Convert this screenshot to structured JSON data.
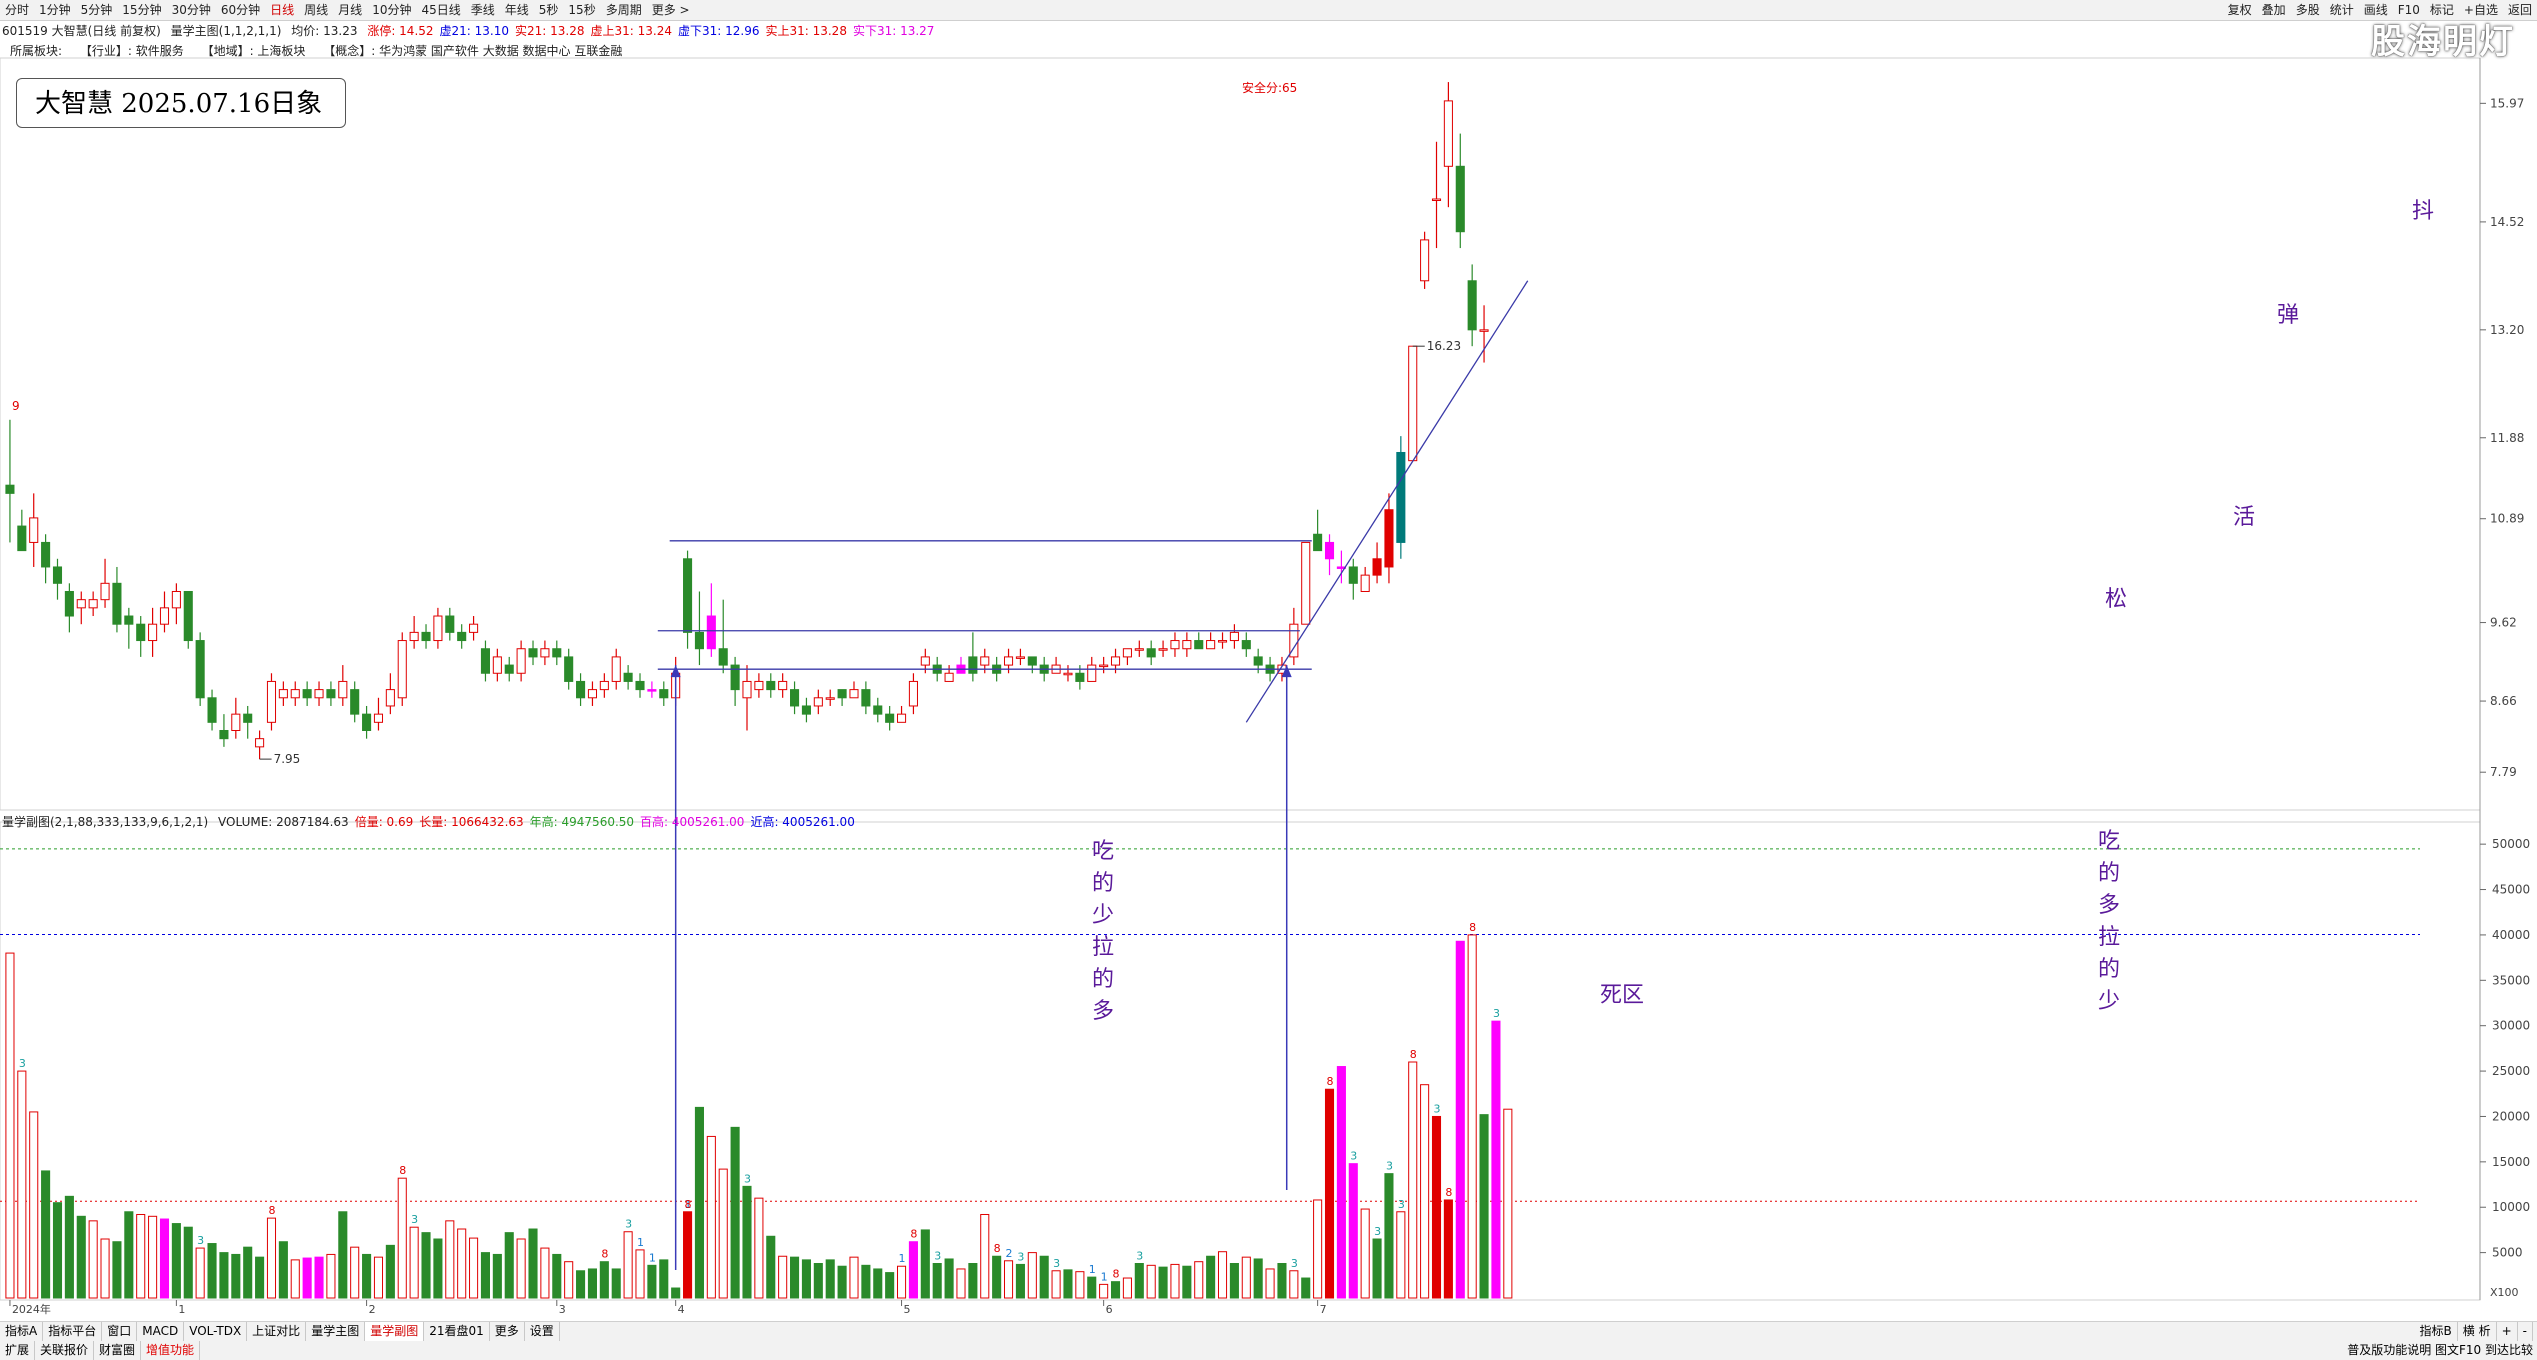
{
  "toolbar": {
    "periods": [
      "分时",
      "1分钟",
      "5分钟",
      "15分钟",
      "30分钟",
      "60分钟",
      "日线",
      "周线",
      "月线",
      "10分钟",
      "45日线",
      "季线",
      "年线",
      "5秒",
      "15秒",
      "多周期",
      "更多 >"
    ],
    "active": "日线",
    "right": [
      "复权",
      "叠加",
      "多股",
      "统计",
      "画线",
      "F10",
      "标记",
      "+自选",
      "返回"
    ]
  },
  "info": {
    "code": "601519 大智慧(日线 前复权)",
    "indicator": "量学主图(1,1,2,1,1)",
    "avg": "均价: 13.23",
    "items": [
      {
        "text": "涨停: 14.52",
        "color": "#e00000"
      },
      {
        "text": "虚21: 13.10",
        "color": "#0000e0"
      },
      {
        "text": "实21: 13.28",
        "color": "#e00000"
      },
      {
        "text": "虚上31: 13.24",
        "color": "#e00000"
      },
      {
        "text": "虚下31: 12.96",
        "color": "#0000e0"
      },
      {
        "text": "实上31: 13.28",
        "color": "#e00000"
      },
      {
        "text": "实下31: 13.27",
        "color": "#e000e0"
      }
    ]
  },
  "sector": {
    "label": "所属板块:",
    "industry": "【行业】: 软件服务",
    "region": "【地域】: 上海板块",
    "concept": "【概念】: 华为鸿蒙 国产软件 大数据 数据中心 互联金融"
  },
  "date_box": "大智慧 2025.07.16日象",
  "watermark": "股海明灯",
  "safety_score": "安全分:65",
  "annotations": {
    "left_stack": [
      "吃",
      "的",
      "少",
      "拉",
      "的",
      "多"
    ],
    "right_stack": [
      "吃",
      "的",
      "多",
      "拉",
      "的",
      "少"
    ],
    "dead_zone": "死区",
    "song": "松",
    "huo": "活",
    "dan": "弹",
    "dou": "抖"
  },
  "volume_header": {
    "name": "量学副图(2,1,88,333,133,9,6,1,2,1)",
    "items": [
      {
        "text": "VOLUME: 2087184.63",
        "color": "#222222"
      },
      {
        "text": "倍量: 0.69",
        "color": "#e00000"
      },
      {
        "text": "长量: 1066432.63",
        "color": "#e00000"
      },
      {
        "text": "年高: 4947560.50",
        "color": "#2a9d2a"
      },
      {
        "text": "百高: 4005261.00",
        "color": "#e000e0"
      },
      {
        "text": "近高: 4005261.00",
        "color": "#0000e0"
      }
    ]
  },
  "bottom": {
    "row1": [
      "指标A",
      "指标平台",
      "窗口",
      "MACD",
      "VOL-TDX",
      "上证对比",
      "量学主图",
      "量学副图",
      "21看盘01",
      "更多",
      "设置"
    ],
    "row1_active": "量学副图",
    "row2": [
      "扩展",
      "关联报价",
      "财富圈",
      "增值功能"
    ],
    "right1": [
      "指标B",
      "横 析",
      "+",
      "-"
    ],
    "right2": "普及版功能说明 图文F10 到达比较"
  },
  "chart_data": {
    "type": "candlestick",
    "price_axis": {
      "ticks": [
        15.97,
        14.52,
        13.2,
        11.88,
        10.89,
        9.62,
        8.66,
        7.79
      ],
      "range": [
        7.45,
        16.5
      ]
    },
    "volume_axis": {
      "ticks": [
        50000,
        45000,
        40000,
        35000,
        30000,
        25000,
        20000,
        15000,
        10000,
        5000
      ],
      "range": [
        0,
        52000
      ],
      "unit": "X100"
    },
    "x_labels": [
      "2024年",
      "1",
      "2",
      "3",
      "4",
      "5",
      "6",
      "7"
    ],
    "x_label_index": [
      0,
      14,
      30,
      46,
      56,
      75,
      92,
      110
    ],
    "price_labels": [
      {
        "index": 21,
        "text": "7.95"
      },
      {
        "index": 118,
        "text": "16.23"
      },
      {
        "index": 0,
        "text": "9"
      }
    ],
    "candles": [
      [
        11.3,
        11.2,
        12.1,
        10.6
      ],
      [
        10.8,
        10.5,
        11.0,
        10.5
      ],
      [
        10.6,
        10.9,
        11.2,
        10.3
      ],
      [
        10.6,
        10.3,
        10.7,
        10.1
      ],
      [
        10.3,
        10.1,
        10.4,
        9.9
      ],
      [
        10.0,
        9.7,
        10.1,
        9.5
      ],
      [
        9.8,
        9.9,
        10.0,
        9.6
      ],
      [
        9.8,
        9.9,
        10.0,
        9.7
      ],
      [
        9.9,
        10.1,
        10.4,
        9.8
      ],
      [
        10.1,
        9.6,
        10.3,
        9.5
      ],
      [
        9.7,
        9.6,
        9.8,
        9.3
      ],
      [
        9.6,
        9.4,
        9.7,
        9.2
      ],
      [
        9.4,
        9.6,
        9.8,
        9.2
      ],
      [
        9.6,
        9.8,
        10.0,
        9.5
      ],
      [
        9.8,
        10.0,
        10.1,
        9.6
      ],
      [
        10.0,
        9.4,
        10.0,
        9.3
      ],
      [
        9.4,
        8.7,
        9.5,
        8.6
      ],
      [
        8.7,
        8.4,
        8.8,
        8.3
      ],
      [
        8.3,
        8.2,
        8.5,
        8.1
      ],
      [
        8.3,
        8.5,
        8.7,
        8.2
      ],
      [
        8.5,
        8.4,
        8.6,
        8.2
      ],
      [
        8.1,
        8.2,
        8.3,
        7.95
      ],
      [
        8.4,
        8.9,
        9.0,
        8.3
      ],
      [
        8.7,
        8.8,
        8.9,
        8.6
      ],
      [
        8.7,
        8.8,
        8.9,
        8.6
      ],
      [
        8.8,
        8.7,
        8.9,
        8.6
      ],
      [
        8.7,
        8.8,
        8.9,
        8.6
      ],
      [
        8.8,
        8.7,
        8.9,
        8.6
      ],
      [
        8.7,
        8.9,
        9.1,
        8.6
      ],
      [
        8.8,
        8.5,
        8.9,
        8.4
      ],
      [
        8.5,
        8.3,
        8.6,
        8.2
      ],
      [
        8.4,
        8.5,
        8.7,
        8.3
      ],
      [
        8.6,
        8.8,
        9.0,
        8.5
      ],
      [
        8.7,
        9.4,
        9.5,
        8.6
      ],
      [
        9.4,
        9.5,
        9.7,
        9.3
      ],
      [
        9.5,
        9.4,
        9.6,
        9.3
      ],
      [
        9.4,
        9.7,
        9.8,
        9.3
      ],
      [
        9.7,
        9.5,
        9.8,
        9.4
      ],
      [
        9.5,
        9.4,
        9.6,
        9.3
      ],
      [
        9.5,
        9.6,
        9.7,
        9.4
      ],
      [
        9.3,
        9.0,
        9.4,
        8.9
      ],
      [
        9.0,
        9.2,
        9.3,
        8.9
      ],
      [
        9.1,
        9.0,
        9.2,
        8.9
      ],
      [
        9.0,
        9.3,
        9.4,
        8.9
      ],
      [
        9.3,
        9.2,
        9.4,
        9.1
      ],
      [
        9.2,
        9.3,
        9.4,
        9.1
      ],
      [
        9.3,
        9.2,
        9.4,
        9.1
      ],
      [
        9.2,
        8.9,
        9.3,
        8.8
      ],
      [
        8.9,
        8.7,
        9.0,
        8.6
      ],
      [
        8.7,
        8.8,
        8.9,
        8.6
      ],
      [
        8.8,
        8.9,
        9.0,
        8.7
      ],
      [
        8.9,
        9.2,
        9.3,
        8.8
      ],
      [
        9.0,
        8.9,
        9.1,
        8.8
      ],
      [
        8.9,
        8.8,
        9.0,
        8.7
      ],
      [
        8.8,
        8.8,
        8.9,
        8.7
      ],
      [
        8.8,
        8.7,
        8.9,
        8.6
      ],
      [
        8.7,
        9.0,
        9.2,
        8.6
      ],
      [
        10.4,
        9.5,
        10.5,
        9.3
      ],
      [
        9.5,
        9.3,
        10.0,
        9.1
      ],
      [
        9.3,
        9.7,
        10.1,
        9.2
      ],
      [
        9.3,
        9.1,
        9.9,
        9.0
      ],
      [
        9.1,
        8.8,
        9.2,
        8.6
      ],
      [
        8.7,
        8.9,
        9.1,
        8.3
      ],
      [
        8.8,
        8.9,
        9.0,
        8.7
      ],
      [
        8.9,
        8.8,
        9.0,
        8.7
      ],
      [
        8.8,
        8.9,
        9.0,
        8.7
      ],
      [
        8.8,
        8.6,
        8.9,
        8.5
      ],
      [
        8.6,
        8.5,
        8.7,
        8.4
      ],
      [
        8.6,
        8.7,
        8.8,
        8.5
      ],
      [
        8.7,
        8.7,
        8.8,
        8.6
      ],
      [
        8.8,
        8.7,
        8.8,
        8.6
      ],
      [
        8.7,
        8.8,
        8.9,
        8.7
      ],
      [
        8.8,
        8.6,
        8.9,
        8.5
      ],
      [
        8.6,
        8.5,
        8.7,
        8.4
      ],
      [
        8.5,
        8.4,
        8.6,
        8.3
      ],
      [
        8.4,
        8.5,
        8.6,
        8.4
      ],
      [
        8.6,
        8.9,
        9.0,
        8.5
      ],
      [
        9.1,
        9.2,
        9.3,
        9.0
      ],
      [
        9.1,
        9.0,
        9.2,
        8.9
      ],
      [
        8.9,
        9.0,
        9.1,
        8.9
      ],
      [
        9.0,
        9.1,
        9.2,
        9.0
      ],
      [
        9.2,
        9.0,
        9.5,
        8.9
      ],
      [
        9.1,
        9.2,
        9.3,
        9.0
      ],
      [
        9.1,
        9.0,
        9.2,
        8.9
      ],
      [
        9.1,
        9.2,
        9.3,
        9.0
      ],
      [
        9.2,
        9.2,
        9.3,
        9.1
      ],
      [
        9.2,
        9.1,
        9.2,
        9.0
      ],
      [
        9.1,
        9.0,
        9.2,
        8.9
      ],
      [
        9.0,
        9.1,
        9.2,
        9.0
      ],
      [
        9.0,
        9.0,
        9.1,
        8.9
      ],
      [
        9.0,
        8.9,
        9.1,
        8.8
      ],
      [
        8.9,
        9.1,
        9.2,
        8.9
      ],
      [
        9.1,
        9.1,
        9.2,
        9.0
      ],
      [
        9.1,
        9.2,
        9.3,
        9.0
      ],
      [
        9.2,
        9.3,
        9.3,
        9.1
      ],
      [
        9.3,
        9.3,
        9.4,
        9.2
      ],
      [
        9.3,
        9.2,
        9.4,
        9.1
      ],
      [
        9.3,
        9.3,
        9.4,
        9.2
      ],
      [
        9.3,
        9.4,
        9.5,
        9.2
      ],
      [
        9.3,
        9.4,
        9.5,
        9.2
      ],
      [
        9.4,
        9.3,
        9.5,
        9.3
      ],
      [
        9.3,
        9.4,
        9.5,
        9.3
      ],
      [
        9.4,
        9.4,
        9.5,
        9.3
      ],
      [
        9.4,
        9.5,
        9.6,
        9.3
      ],
      [
        9.4,
        9.3,
        9.5,
        9.2
      ],
      [
        9.2,
        9.1,
        9.3,
        9.0
      ],
      [
        9.1,
        9.0,
        9.2,
        8.9
      ],
      [
        9.0,
        9.1,
        9.2,
        8.9
      ],
      [
        9.2,
        9.6,
        9.8,
        9.1
      ],
      [
        9.6,
        10.6,
        10.6,
        9.6
      ],
      [
        10.7,
        10.5,
        11.0,
        10.5
      ],
      [
        10.6,
        10.4,
        10.7,
        10.2
      ],
      [
        10.3,
        10.3,
        10.5,
        10.1
      ],
      [
        10.3,
        10.1,
        10.4,
        9.9
      ],
      [
        10.0,
        10.2,
        10.3,
        10.0
      ],
      [
        10.2,
        10.4,
        10.6,
        10.1
      ],
      [
        10.3,
        11.0,
        11.2,
        10.1
      ],
      [
        10.6,
        11.7,
        11.9,
        10.4
      ],
      [
        11.6,
        13.0,
        13.0,
        11.6
      ],
      [
        13.8,
        14.3,
        14.4,
        13.7
      ],
      [
        14.8,
        14.8,
        15.5,
        14.2
      ],
      [
        15.2,
        16.0,
        16.23,
        14.7
      ],
      [
        15.2,
        14.4,
        15.6,
        14.2
      ],
      [
        13.8,
        13.2,
        14.0,
        13.0
      ],
      [
        13.2,
        13.2,
        13.5,
        12.8
      ]
    ],
    "candle_colors": {
      "54": "#ff00ff",
      "59": "#ff00ff",
      "111": "#ff00ff",
      "112": "#ff00ff",
      "80": "#ff00ff",
      "116": "#e00000",
      "115": "#e00000",
      "117": "#007a7a",
      "111b": "#e00000"
    },
    "volumes": [
      38000,
      25000,
      20500,
      14000,
      10500,
      11200,
      9000,
      8500,
      6500,
      6200,
      9500,
      9200,
      9000,
      8700,
      8200,
      7800,
      5500,
      6000,
      5000,
      4800,
      5600,
      4500,
      8800,
      6200,
      4200,
      4400,
      4500,
      4800,
      9500,
      5600,
      4800,
      4500,
      5800,
      13200,
      7800,
      7200,
      6500,
      8500,
      7600,
      6600,
      5000,
      4800,
      7200,
      6500,
      7600,
      5500,
      4800,
      4000,
      3000,
      3200,
      4000,
      3200,
      7300,
      5300,
      3600,
      4200,
      1100,
      9500,
      21000,
      17800,
      14200,
      18800,
      12300,
      11000,
      6800,
      4600,
      4500,
      4200,
      3800,
      4200,
      3500,
      4500,
      3600,
      3200,
      2800,
      3500,
      6200,
      7500,
      3800,
      4300,
      3200,
      3800,
      9200,
      4600,
      4100,
      3700,
      5000,
      4600,
      3000,
      3100,
      2900,
      2300,
      1500,
      1800,
      2200,
      3800,
      3600,
      3400,
      3700,
      3500,
      4000,
      4600,
      5100,
      3800,
      4500,
      4300,
      3200,
      3800,
      3000,
      2200,
      10800,
      23000,
      25500,
      14800,
      9800,
      6500,
      13700,
      9500,
      26000,
      23500,
      20000,
      10800,
      39300,
      40000,
      20200,
      30500,
      20800
    ],
    "volume_colors": {
      "57": "#e00000",
      "13": "#ff00ff",
      "25": "#ff00ff",
      "26": "#ff00ff",
      "76": "#ff00ff",
      "111": "#e00000",
      "112": "#ff00ff",
      "113": "#ff00ff",
      "120": "#e00000",
      "121": "#e00000",
      "122": "#ff00ff",
      "125": "#ff00ff"
    },
    "volume_up": [
      0,
      1,
      2,
      7,
      8,
      11,
      12,
      16,
      22,
      24,
      27,
      29,
      31,
      33,
      34,
      37,
      38,
      39,
      43,
      45,
      47,
      52,
      53,
      57,
      59,
      60,
      63,
      65,
      71,
      75,
      76,
      80,
      82,
      84,
      86,
      88,
      90,
      92,
      94,
      96,
      98,
      100,
      102,
      104,
      106,
      108,
      110,
      111,
      112,
      114,
      117,
      118,
      119,
      123,
      126
    ],
    "volume_labels": [
      {
        "index": 1,
        "text": "3"
      },
      {
        "index": 16,
        "text": "3"
      },
      {
        "index": 22,
        "text": "8"
      },
      {
        "index": 33,
        "text": "8"
      },
      {
        "index": 34,
        "text": "3"
      },
      {
        "index": 50,
        "text": "8"
      },
      {
        "index": 52,
        "text": "3"
      },
      {
        "index": 53,
        "text": "1"
      },
      {
        "index": 54,
        "text": "1"
      },
      {
        "index": 57,
        "text": "1"
      },
      {
        "index": 57,
        "text": "8"
      },
      {
        "index": 62,
        "text": "3"
      },
      {
        "index": 76,
        "text": "8"
      },
      {
        "index": 78,
        "text": "3"
      },
      {
        "index": 75,
        "text": "1"
      },
      {
        "index": 83,
        "text": "8"
      },
      {
        "index": 84,
        "text": "2"
      },
      {
        "index": 85,
        "text": "3"
      },
      {
        "index": 88,
        "text": "3"
      },
      {
        "index": 91,
        "text": "1"
      },
      {
        "index": 92,
        "text": "1"
      },
      {
        "index": 93,
        "text": "8"
      },
      {
        "index": 95,
        "text": "3"
      },
      {
        "index": 108,
        "text": "3"
      },
      {
        "index": 111,
        "text": "8"
      },
      {
        "index": 113,
        "text": "3"
      },
      {
        "index": 115,
        "text": "3"
      },
      {
        "index": 116,
        "text": "3"
      },
      {
        "index": 118,
        "text": "8"
      },
      {
        "index": 120,
        "text": "3"
      },
      {
        "index": 123,
        "text": "8"
      },
      {
        "index": 125,
        "text": "3"
      },
      {
        "index": 117,
        "text": "3"
      },
      {
        "index": 121,
        "text": "8"
      }
    ]
  }
}
